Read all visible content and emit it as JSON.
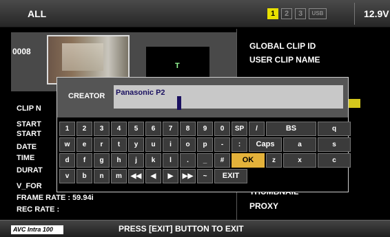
{
  "header": {
    "title": "ALL",
    "slots": [
      "1",
      "2",
      "3",
      "USB"
    ],
    "active_slot": "1",
    "voltage": "12.9V"
  },
  "clip": {
    "number": "0008",
    "preview_label": "T"
  },
  "left_fields": {
    "clip": "CLIP N",
    "start1": "START",
    "start2": "START",
    "date": "DATE",
    "time": "TIME",
    "duration": "DURAT",
    "format": "V_FOR",
    "frame_rate": "FRAME RATE   : 59.94i",
    "rec_rate": "REC RATE        :"
  },
  "right_fields": {
    "global_clip_id": "GLOBAL CLIP ID",
    "user_clip_name": "USER CLIP NAME",
    "thumbnail": "THUMBNAIL",
    "proxy": "PROXY"
  },
  "dialog": {
    "label": "CREATOR",
    "value": "Panasonic P2",
    "keys": [
      [
        "1",
        "2",
        "3",
        "4",
        "5",
        "6",
        "7",
        "8",
        "9",
        "0",
        "SP",
        "/",
        "BS"
      ],
      [
        "q",
        "w",
        "e",
        "r",
        "t",
        "y",
        "u",
        "i",
        "o",
        "p",
        "-",
        ":",
        "Caps"
      ],
      [
        "a",
        "s",
        "d",
        "f",
        "g",
        "h",
        "j",
        "k",
        "l",
        ".",
        "_",
        "#",
        "OK"
      ],
      [
        "z",
        "x",
        "c",
        "v",
        "b",
        "n",
        "m",
        "◀◀",
        "◀",
        "▶",
        "▶▶",
        "~",
        "EXIT"
      ]
    ],
    "highlighted_key": "OK"
  },
  "footer": {
    "logo": "AVC Intra 100",
    "hint": "PRESS [EXIT] BUTTON TO EXIT"
  }
}
